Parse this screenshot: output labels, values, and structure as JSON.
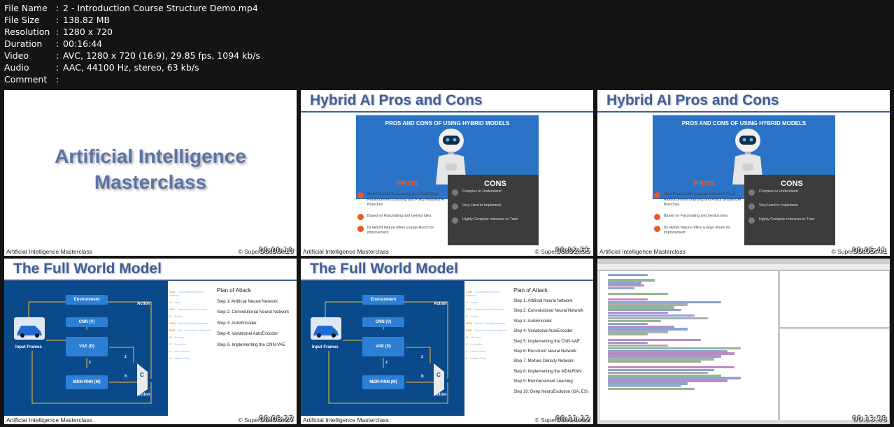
{
  "file_info": [
    {
      "key": "File Name",
      "value": "2 - Introduction Course Structure Demo.mp4"
    },
    {
      "key": "File Size",
      "value": "138.82 MB"
    },
    {
      "key": "Resolution",
      "value": "1280 x 720"
    },
    {
      "key": "Duration",
      "value": "00:16:44"
    },
    {
      "key": "Video",
      "value": "AVC, 1280 x 720 (16:9), 29.85 fps, 1094 kb/s"
    },
    {
      "key": "Audio",
      "value": "AAC, 44100 Hz, stereo, 63 kb/s"
    },
    {
      "key": "Comment",
      "value": ""
    }
  ],
  "thumbnails": [
    {
      "timestamp": "00:00:10"
    },
    {
      "timestamp": "00:02:55"
    },
    {
      "timestamp": "00:05:41"
    },
    {
      "timestamp": "00:08:27"
    },
    {
      "timestamp": "00:11:12"
    },
    {
      "timestamp": "00:13:58"
    }
  ],
  "footer": {
    "course": "Artificial Intelligence Masterclass",
    "copyright": "© SuperDataScience"
  },
  "slide_title": {
    "line1": "Artificial Intelligence",
    "line2": "Masterclass"
  },
  "pros_cons": {
    "heading": "Hybrid AI Pros and Cons",
    "box_title": "PROS AND CONS OF USING HYBRID MODELS",
    "pros_label": "PROS",
    "cons_label": "CONS",
    "pros": [
      "Most Powerful AI model by far in both Deep Reinforcement Learning and Policy Gradient AI Branches",
      "Based on Fascinating and Genius idea",
      "Its Hybrid Nature offers a large Room for improvement"
    ],
    "cons": [
      "Complex to Understand",
      "Very Hard to Implement",
      "Highly Compute Intensive to Train"
    ]
  },
  "world_model": {
    "heading": "The Full World Model",
    "plan_title": "Plan of Attack",
    "boxes": {
      "environment": "Environment",
      "cnn": "CNN (V)",
      "vae": "VAE (D)",
      "mdn": "MDN-RNN (M)",
      "controller": "C"
    },
    "labels": {
      "action_top": "Action",
      "action_bottom": "Action",
      "input_frames": "Input Frames",
      "z1": "z",
      "z2": "z",
      "h": "h"
    },
    "legend": [
      {
        "k": "CNN",
        "v": " - Convolutional Neural Network"
      },
      {
        "k": "V",
        "v": " - Vision"
      },
      {
        "k": "VAE",
        "v": " - Variational AutoEncoder"
      },
      {
        "k": "D",
        "v": " - Dream"
      },
      {
        "k": "MDN",
        "v": " - Mixture Density Network"
      },
      {
        "k": "RNN",
        "v": " - Recurrent Neural Network"
      },
      {
        "k": "M",
        "v": " - Memory"
      },
      {
        "k": "C",
        "v": " - Controller"
      },
      {
        "k": "z",
        "v": " - Latent Vector"
      },
      {
        "k": "h",
        "v": " - Hidden State"
      }
    ],
    "steps_short": [
      "Step 1: Artificial Neural Network",
      "Step 2: Convolutional Neural Network",
      "Step 3: AutoEncoder",
      "Step 4: Variational AutoEncoder",
      "Step 5: Implementing the CNN-VAE"
    ],
    "steps_long": [
      "Step 1: Artificial Neural Network",
      "Step 2: Convolutional Neural Network",
      "Step 3: AutoEncoder",
      "Step 4: Variational AutoEncoder",
      "Step 5: Implementing the CNN-VAE",
      "Step 6: Recurrent Neural Network",
      "Step 7: Mixture Density Network",
      "Step 8: Implementing the MDN-RNN",
      "Step 9: Reinforcement Learning",
      "Step 10: Deep NeuroEvolution (GA, ES)"
    ]
  },
  "colors": {
    "background": "#141414",
    "slide_blue": "#3f5e9b",
    "pro_orange": "#e85a24",
    "diagram_blue": "#0a4a8a"
  }
}
